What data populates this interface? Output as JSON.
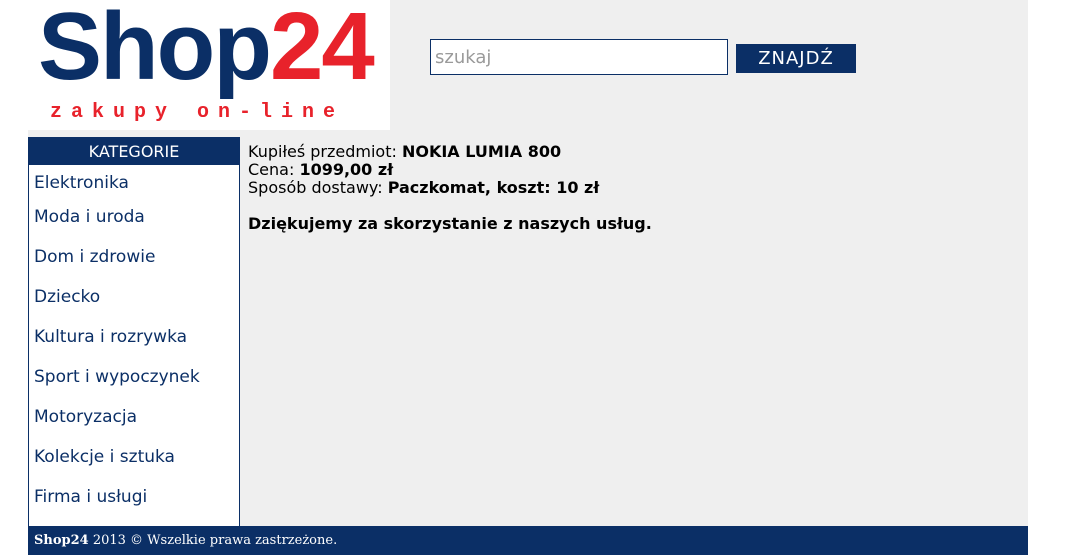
{
  "logo": {
    "word_shop": "Shop",
    "word_num": "24",
    "tagline": "zakupy on-line",
    "colors": {
      "shop": "#0b2f66",
      "num": "#e8222b"
    }
  },
  "search": {
    "placeholder": "szukaj",
    "value": "",
    "button_label": "ZNAJDŹ"
  },
  "sidebar": {
    "title": "KATEGORIE",
    "items": [
      {
        "label": "Elektronika"
      },
      {
        "label": "Moda i uroda"
      },
      {
        "label": "Dom i zdrowie"
      },
      {
        "label": "Dziecko"
      },
      {
        "label": "Kultura i rozrywka"
      },
      {
        "label": "Sport i wypoczynek"
      },
      {
        "label": "Motoryzacja"
      },
      {
        "label": "Kolekcje i sztuka"
      },
      {
        "label": "Firma i usługi"
      }
    ]
  },
  "order": {
    "item_label": "Kupiłeś przedmiot: ",
    "item_value": "NOKIA LUMIA 800",
    "price_label": "Cena: ",
    "price_value": "1099,00 zł",
    "delivery_label": "Sposób dostawy: ",
    "delivery_value": "Paczkomat, koszt: 10 zł",
    "thanks": "Dziękujemy za skorzystanie z naszych usług."
  },
  "footer": {
    "brand": "Shop24",
    "text": " 2013 © Wszelkie prawa zastrzeżone."
  },
  "colors": {
    "brand_blue": "#0b2f66",
    "brand_red": "#e8222b",
    "page_background": "#efefef"
  }
}
